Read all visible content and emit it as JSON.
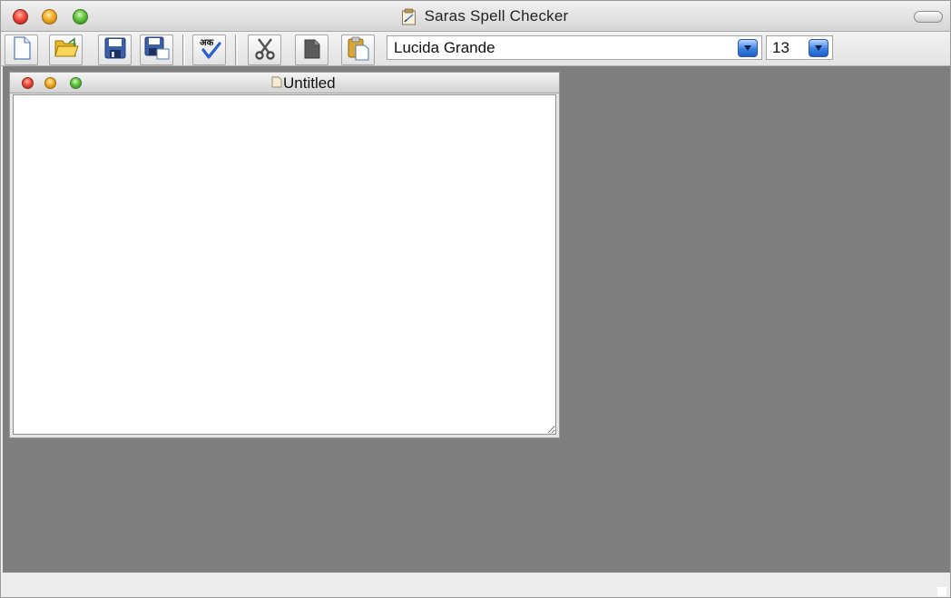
{
  "app": {
    "title": "Saras Spell Checker"
  },
  "toolbar": {
    "buttons": [
      {
        "name": "new-document",
        "icon": "new-document-icon"
      },
      {
        "name": "open",
        "icon": "open-folder-icon"
      },
      {
        "name": "save",
        "icon": "save-icon"
      },
      {
        "name": "save-as",
        "icon": "save-as-icon"
      },
      {
        "name": "spell-check",
        "icon": "spell-check-icon",
        "glyph_text": "अक"
      },
      {
        "name": "cut",
        "icon": "scissors-icon"
      },
      {
        "name": "copy",
        "icon": "copy-icon"
      },
      {
        "name": "paste",
        "icon": "paste-icon"
      }
    ],
    "font_family": "Lucida Grande",
    "font_size": "13"
  },
  "document": {
    "title": "Untitled",
    "content": ""
  },
  "colors": {
    "workspace_background": "#7f7f7f",
    "dropdown_accent": "#3a7fe3"
  }
}
